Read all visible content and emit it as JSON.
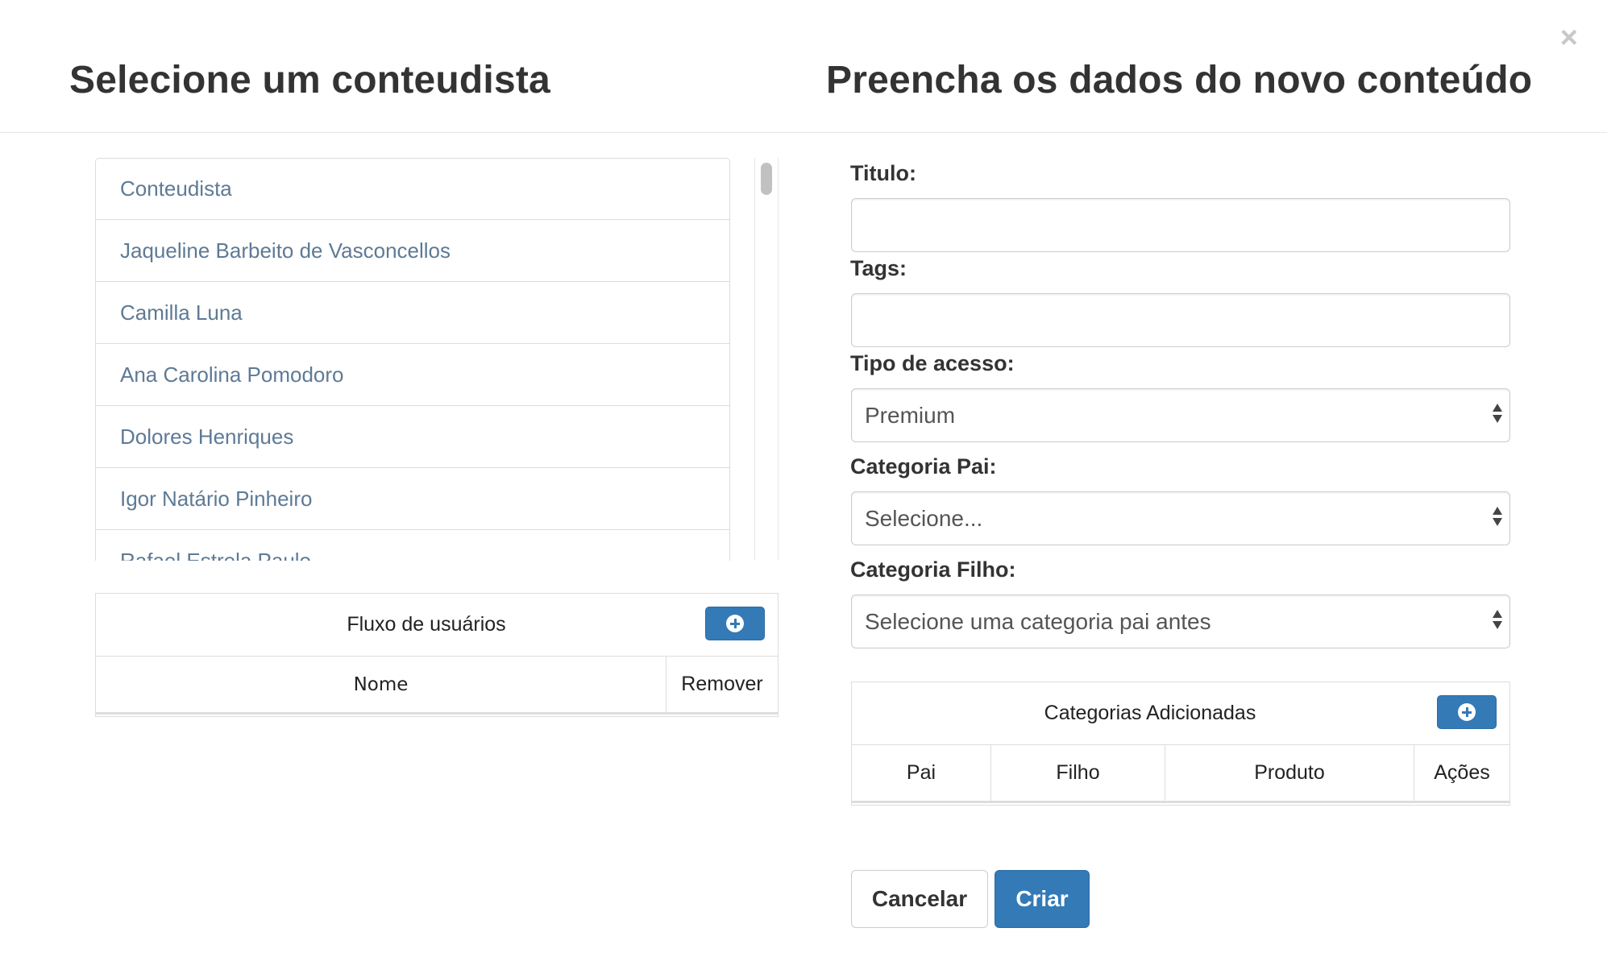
{
  "modal": {
    "close_symbol": "×",
    "left_title": "Selecione um conteudista",
    "right_title": "Preencha os dados do novo conteúdo"
  },
  "content_authors": {
    "items": [
      {
        "label": "Conteudista"
      },
      {
        "label": "Jaqueline Barbeito de Vasconcellos"
      },
      {
        "label": "Camilla Luna"
      },
      {
        "label": "Ana Carolina Pomodoro"
      },
      {
        "label": "Dolores Henriques"
      },
      {
        "label": "Igor Natário Pinheiro"
      },
      {
        "label": "Rafael Estrela Paulo"
      }
    ]
  },
  "user_flow": {
    "title": "Fluxo de usuários",
    "columns": [
      "Nome",
      "Remover"
    ],
    "add_icon": "plus-circle-icon"
  },
  "form": {
    "title_label": "Titulo:",
    "title_value": "",
    "tags_label": "Tags:",
    "tags_value": "",
    "access_label": "Tipo de acesso:",
    "access_value": "Premium",
    "parent_category_label": "Categoria Pai:",
    "parent_category_value": "Selecione...",
    "child_category_label": "Categoria Filho:",
    "child_category_value": "Selecione uma categoria pai antes"
  },
  "added_categories": {
    "title": "Categorias Adicionadas",
    "columns": [
      "Pai",
      "Filho",
      "Produto",
      "Ações"
    ],
    "add_icon": "plus-circle-icon"
  },
  "actions": {
    "cancel_label": "Cancelar",
    "create_label": "Criar"
  },
  "colors": {
    "primary": "#337ab7",
    "link": "#5e7a95",
    "border": "#dddddd"
  }
}
